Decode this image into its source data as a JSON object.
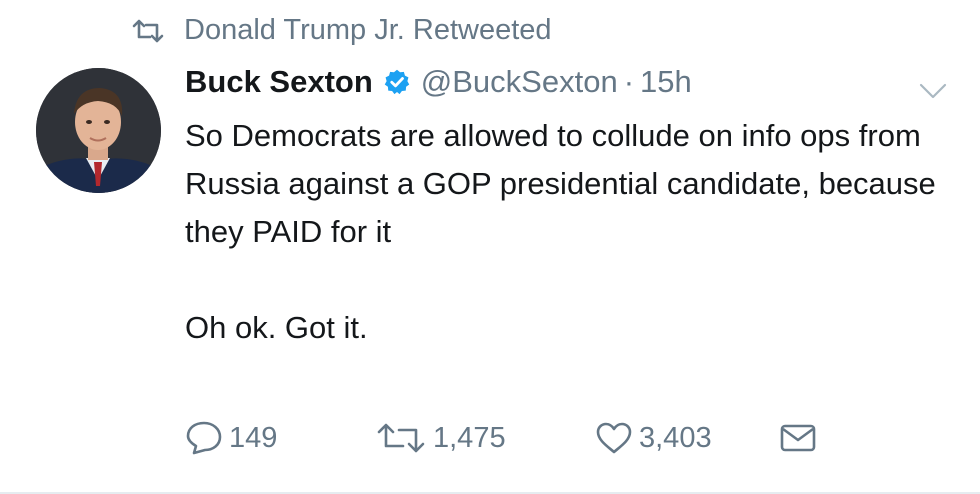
{
  "retweet_context": {
    "text": "Donald Trump Jr. Retweeted",
    "icon": "retweet-icon"
  },
  "tweet": {
    "author": {
      "display_name": "Buck Sexton",
      "handle": "@BuckSexton",
      "verified": true,
      "avatar": "avatar-photo"
    },
    "separator": "·",
    "time": "15h",
    "text_paragraphs": [
      "So Democrats are allowed to collude on info ops from Russia against a GOP presidential candidate, because they PAID for it",
      "Oh ok. Got it."
    ],
    "actions": {
      "replies": "149",
      "retweets": "1,475",
      "likes": "3,403"
    }
  },
  "colors": {
    "text": "#14171a",
    "secondary": "#657786",
    "verified_blue": "#1da1f2"
  }
}
